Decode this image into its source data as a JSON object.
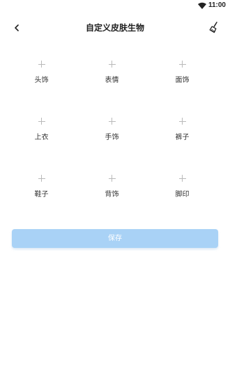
{
  "status_bar": {
    "time": "11:00",
    "icons": [
      "wifi-icon"
    ]
  },
  "header": {
    "back_icon": "chevron-left-icon",
    "title": "自定义皮肤生物",
    "clear_icon": "broom-icon"
  },
  "slots": [
    {
      "label": "头饰",
      "icon": "plus-icon"
    },
    {
      "label": "表情",
      "icon": "plus-icon"
    },
    {
      "label": "面饰",
      "icon": "plus-icon"
    },
    {
      "label": "上衣",
      "icon": "plus-icon"
    },
    {
      "label": "手饰",
      "icon": "plus-icon"
    },
    {
      "label": "裤子",
      "icon": "plus-icon"
    },
    {
      "label": "鞋子",
      "icon": "plus-icon"
    },
    {
      "label": "背饰",
      "icon": "plus-icon"
    },
    {
      "label": "脚印",
      "icon": "plus-icon"
    }
  ],
  "save_button": {
    "label": "保存"
  },
  "colors": {
    "save_button_bg": "#a9d2f6",
    "text": "#222222",
    "plus": "#b9b9b9"
  }
}
